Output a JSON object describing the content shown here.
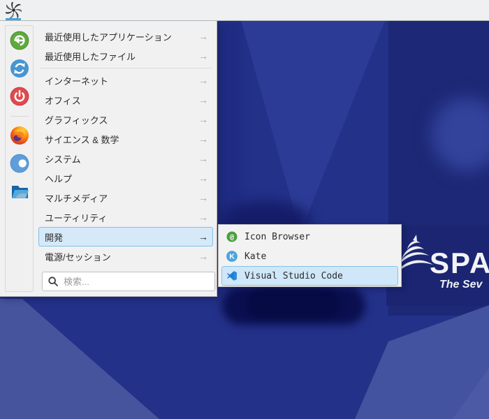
{
  "panel": {
    "app_button": {
      "icon": "sparky-swirl-logo",
      "indicator_color": "#46a3dc"
    }
  },
  "menu": {
    "arrow_glyph": "→",
    "favorites": [
      {
        "id": "log-out",
        "icon": "logout-icon"
      },
      {
        "id": "restart",
        "icon": "restart-icon"
      },
      {
        "id": "shut-down",
        "icon": "shutdown-icon",
        "separator_after": true
      },
      {
        "id": "firefox",
        "icon": "firefox-icon"
      },
      {
        "id": "blue-app",
        "icon": "blue-dot-app-icon"
      },
      {
        "id": "file-manager",
        "icon": "file-manager-icon"
      }
    ],
    "categories": [
      {
        "label": "最近使用したアプリケーション",
        "separator_after": false
      },
      {
        "label": "最近使用したファイル",
        "separator_after": true
      },
      {
        "label": "インターネット"
      },
      {
        "label": "オフィス"
      },
      {
        "label": "グラフィックス"
      },
      {
        "label": "サイエンス & 数学"
      },
      {
        "label": "システム"
      },
      {
        "label": "ヘルプ"
      },
      {
        "label": "マルチメディア"
      },
      {
        "label": "ユーティリティ"
      },
      {
        "label": "開発",
        "highlighted": true
      },
      {
        "label": "電源/セッション"
      }
    ],
    "search_placeholder": "検索..."
  },
  "submenu": {
    "items": [
      {
        "label": "Icon Browser",
        "icon": "icon-browser-icon"
      },
      {
        "label": "Kate",
        "icon": "kate-icon"
      },
      {
        "label": "Visual Studio Code",
        "icon": "vscode-icon",
        "highlighted": true
      }
    ]
  },
  "wallpaper": {
    "brand_text": "SPA",
    "tagline": "The Sev",
    "base_color": "#233189",
    "dark_shade": "#1d2876",
    "light_shade": "#46549e",
    "text_color": "#f2f3f7"
  },
  "colors": {
    "highlight_bg": "#d5e9f8",
    "highlight_border": "#7fc0e7",
    "menu_bg": "#f1f1f2",
    "panel_bg": "#eef0f1",
    "vscode_blue": "#1f7ed0",
    "kate_blue": "#4aa6e0",
    "iconbrowser_green": "#4a9e3e",
    "logout_green": "#5fa93e",
    "restart_blue": "#4795d2",
    "shutdown_red": "#e04a4d"
  }
}
